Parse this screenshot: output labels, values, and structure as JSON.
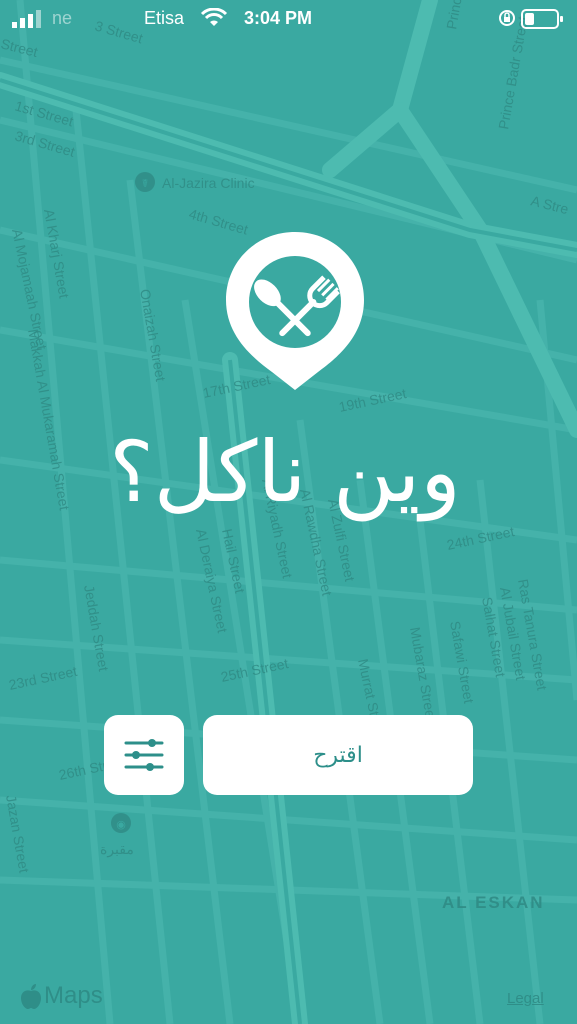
{
  "status_bar": {
    "carrier_left": "ne",
    "carrier": "Etisa",
    "time": "3:04 PM"
  },
  "map": {
    "streets": [
      "3 Street",
      "1st Street",
      "3rd Street",
      "4th Street",
      "Al Kharj Street",
      "Al Mojamaah Street",
      "Makkah Al Mukaramah Street",
      "Onaizah Street",
      "17th Street",
      "19th Street",
      "Al Riyadh Street",
      "Al Rawdha Street",
      "Al Zulfi Street",
      "Hail Street",
      "Al Deraiya Street",
      "24th Street",
      "23rd Street",
      "25th Street",
      "26th Street",
      "Jeddah Street",
      "Jazan Street",
      "Mubaraz Street",
      "Safawi Street",
      "Ras Tanura Street",
      "Al Jubail Street",
      "Salhat Street",
      "Murrat Street",
      "Prince Badr Street",
      "Prince Street",
      "A Stre",
      "Street"
    ],
    "poi_clinic": "Al-Jazira Clinic",
    "poi_cemetery": "مقبرة",
    "area": "AL ESKAN"
  },
  "app": {
    "title": "وين ناكل؟",
    "suggest_button": "اقترح",
    "logo_icon": "fork-spoon-pin-icon",
    "filter_icon": "sliders-icon"
  },
  "footer": {
    "maps_brand": "Maps",
    "legal": "Legal"
  },
  "colors": {
    "background": "#3aa9a1",
    "accent": "#2d8f8a",
    "white": "#ffffff"
  }
}
